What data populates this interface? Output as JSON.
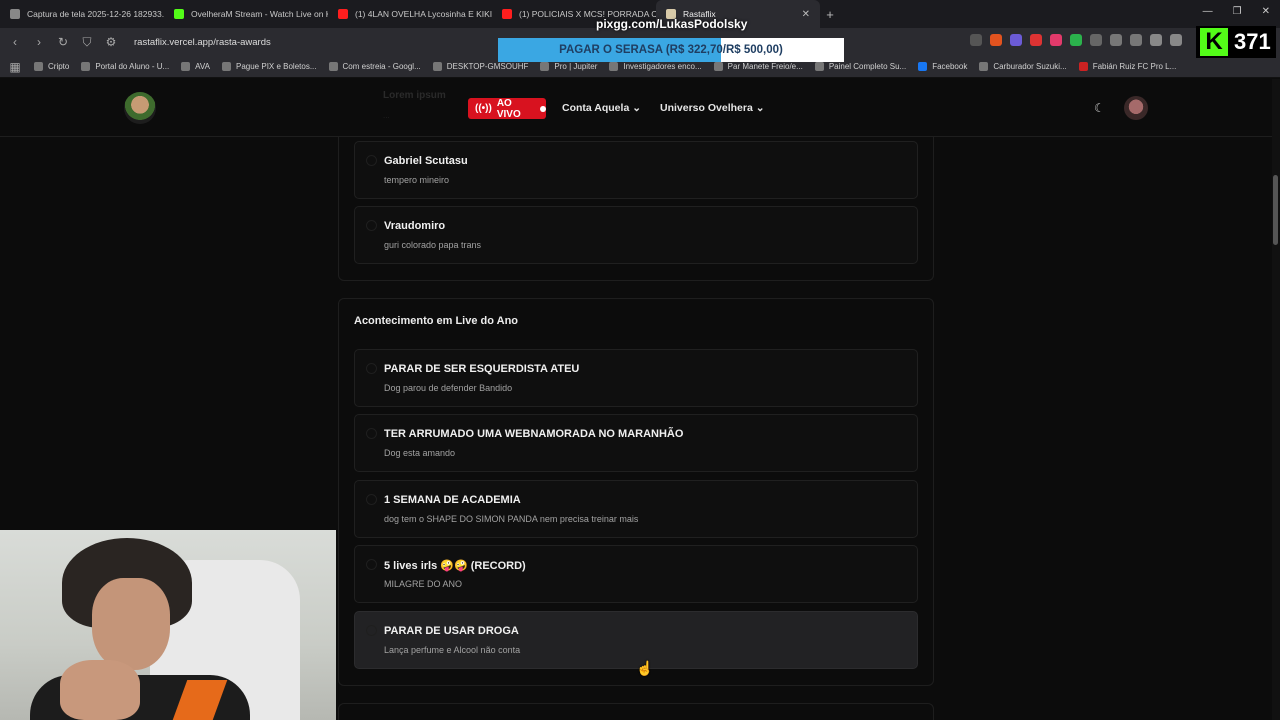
{
  "browser": {
    "tabs": [
      {
        "label": "Captura de tela 2025-12-26 182933...",
        "color": "#888888"
      },
      {
        "label": "OvelheraM Stream - Watch Live on K...",
        "color": "#53fc18"
      },
      {
        "label": "(1) 4LAN OVELHA Lycosinha E KIKIRA...",
        "color": "#ff1e1e"
      },
      {
        "label": "(1) POLICIAIS X MCS! PORRADA COM...",
        "color": "#ff1e1e"
      },
      {
        "label": "Rastaflix",
        "color": "#d7c9a8"
      }
    ],
    "url": "rastaflix.vercel.app/rasta-awards",
    "bookmarks": [
      "Cripto",
      "Portal do Aluno - U...",
      "AVA",
      "Pague PIX e Boletos...",
      "Com estreia - Googl...",
      "DESKTOP-GMSOUHF",
      "Pro | Jupiter",
      "Investigadores enco...",
      "Par Manete Freio/e...",
      "Painel Completo Su...",
      "Facebook",
      "Carburador Suzuki...",
      "Fabián Ruiz FC Pro L..."
    ]
  },
  "overlay": {
    "pix": "pixgg.com/LukasPodolsky",
    "goal_text": "PAGAR O SERASA (R$ 322,70/R$ 500,00)",
    "goal_progress": 0.6454,
    "viewer_count": "371",
    "kick_letter": "K"
  },
  "site": {
    "live_label": "AO VIVO",
    "nav": [
      "Conta Aquela",
      "Universo Ovelhera"
    ],
    "chevron": "⌄",
    "theme_icon": "☾",
    "ghost_title": "Lorem ipsum",
    "ghost_sub": "..."
  },
  "sections": [
    {
      "title": "",
      "items": [
        {
          "title": "Gabriel Scutasu",
          "subtitle": "tempero mineiro"
        },
        {
          "title": "Vraudomiro",
          "subtitle": "guri colorado papa trans"
        }
      ]
    },
    {
      "title": "Acontecimento em Live do Ano",
      "items": [
        {
          "title": "PARAR DE SER ESQUERDISTA ATEU",
          "subtitle": "Dog parou de defender Bandido"
        },
        {
          "title": "TER ARRUMADO UMA WEBNAMORADA NO MARANHÃO",
          "subtitle": "Dog esta amando"
        },
        {
          "title": "1 SEMANA DE ACADEMIA",
          "subtitle": "dog tem o SHAPE DO SIMON PANDA nem precisa treinar mais"
        },
        {
          "title": "5 lives irls 🤪🤪 (RECORD)",
          "subtitle": "MILAGRE DO ANO"
        },
        {
          "title": "PARAR DE USAR DROGA",
          "subtitle": "Lança perfume e Alcool não conta"
        }
      ]
    }
  ]
}
